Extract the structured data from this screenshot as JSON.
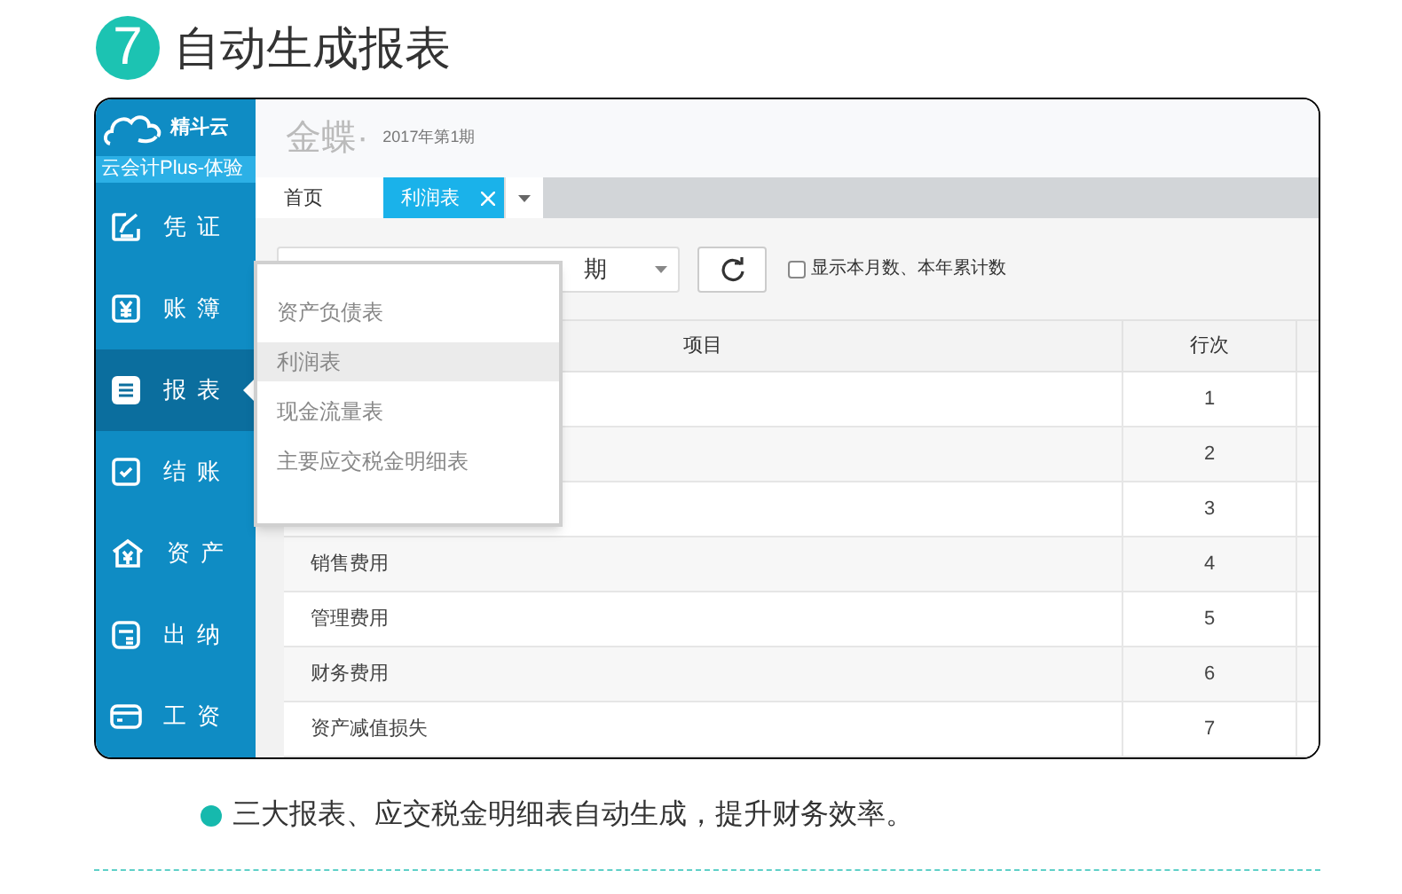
{
  "heading": {
    "step": "7",
    "title": "自动生成报表"
  },
  "app": {
    "brand": "精斗云",
    "edition": "云会计Plus-体验",
    "nav": [
      {
        "label": "凭证",
        "selected": false
      },
      {
        "label": "账簿",
        "selected": false
      },
      {
        "label": "报表",
        "selected": true
      },
      {
        "label": "结账",
        "selected": false
      },
      {
        "label": "资产",
        "selected": false
      },
      {
        "label": "出纳",
        "selected": false
      },
      {
        "label": "工资",
        "selected": false
      }
    ],
    "header": {
      "logo": "金蝶·",
      "period": "2017年第1期"
    },
    "tabs": [
      {
        "label": "首页",
        "selected": false,
        "closable": false
      },
      {
        "label": "利润表",
        "selected": true,
        "closable": true
      }
    ],
    "toolbar": {
      "period_select": "期",
      "checkbox": {
        "label": "显示本月数、本年累计数",
        "checked": false
      }
    },
    "table": {
      "columns": [
        "项目",
        "行次"
      ],
      "rows": [
        {
          "line": "1"
        },
        {
          "line": "2"
        },
        {
          "line": "3"
        },
        {
          "item": "销售费用",
          "line": "4"
        },
        {
          "item": "管理费用",
          "line": "5"
        },
        {
          "item": "财务费用",
          "line": "6"
        },
        {
          "item": "资产减值损失",
          "line": "7"
        }
      ]
    },
    "report_menu": {
      "items": [
        {
          "label": "资产负债表",
          "selected": false
        },
        {
          "label": "利润表",
          "selected": true
        },
        {
          "label": "现金流量表",
          "selected": false
        },
        {
          "label": "主要应交税金明细表",
          "selected": false
        }
      ]
    }
  },
  "caption": "三大报表、应交税金明细表自动生成，提升财务效率。"
}
